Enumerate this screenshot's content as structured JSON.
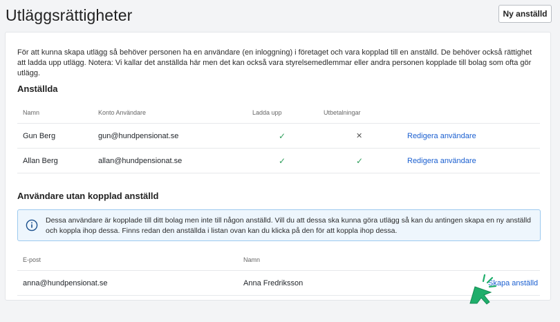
{
  "header": {
    "title": "Utläggsrättigheter",
    "new_employee_label": "Ny anställd"
  },
  "intro": "För att kunna skapa utlägg så behöver personen ha en användare (en inloggning) i företaget och vara kopplad till en anställd. De behöver också rättighet att ladda upp utlägg. Notera: Vi kallar det anställda här men det kan också vara styrelsemedlemmar eller andra personen kopplade till bolag som ofta gör utlägg.",
  "employees": {
    "heading": "Anställda",
    "columns": {
      "name": "Namn",
      "account": "Konto Användare",
      "upload": "Ladda upp",
      "payouts": "Utbetalningar"
    },
    "rows": [
      {
        "name": "Gun Berg",
        "account": "gun@hundpensionat.se",
        "upload": "✓",
        "payouts": "✕",
        "action": "Redigera användare"
      },
      {
        "name": "Allan Berg",
        "account": "allan@hundpensionat.se",
        "upload": "✓",
        "payouts": "✓",
        "action": "Redigera användare"
      }
    ]
  },
  "users_without_employee": {
    "heading": "Användare utan kopplad anställd",
    "info": "Dessa användare är kopplade till ditt bolag men inte till någon anställd. Vill du att dessa ska kunna göra utlägg så kan du antingen skapa en ny anställd och koppla ihop dessa. Finns redan den anställda i listan ovan kan du klicka på den för att koppla ihop dessa.",
    "columns": {
      "email": "E-post",
      "name": "Namn"
    },
    "rows": [
      {
        "email": "anna@hundpensionat.se",
        "name": "Anna Fredriksson",
        "action": "Skapa anställd"
      }
    ]
  },
  "colors": {
    "link": "#1a5fd0",
    "check": "#2e9e5b",
    "info_border": "#9cc9ef",
    "info_bg": "#eef6fd",
    "cursor": "#1fae6b"
  },
  "icons": {
    "info": "info-circle-icon",
    "cursor": "pointer-cursor-icon"
  }
}
